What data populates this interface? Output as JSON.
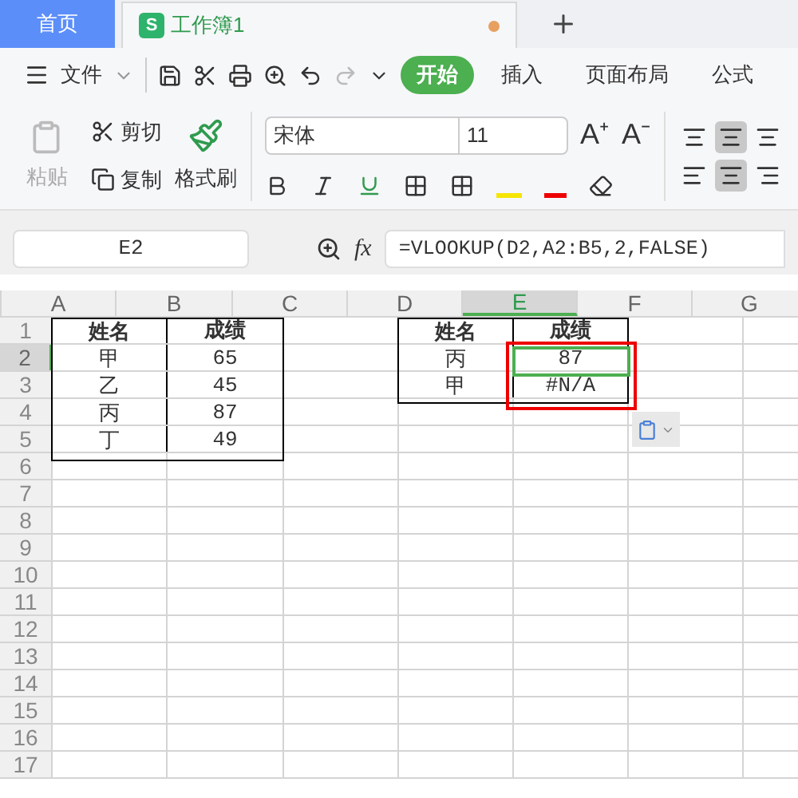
{
  "doc_tabs": [
    {
      "kind": "home",
      "label": "首页",
      "selected": false
    },
    {
      "kind": "doc",
      "badge": "S",
      "label": "工作簿1",
      "selected": true,
      "unsaved": true
    }
  ],
  "menu": {
    "file": "文件",
    "ribbon_tabs": [
      {
        "label": "开始",
        "selected": true
      },
      {
        "label": "插入",
        "selected": false
      },
      {
        "label": "页面布局",
        "selected": false
      },
      {
        "label": "公式",
        "selected": false
      }
    ]
  },
  "clipboard": {
    "paste": {
      "label": "粘贴",
      "disabled": true
    },
    "cut": "剪切",
    "copy": "复制",
    "format_painter": "格式刷"
  },
  "font": {
    "name": "宋体",
    "size": "11",
    "grow": "A⁺",
    "shrink": "A⁻"
  },
  "formula_bar": {
    "name_box": "E2",
    "fx": "fx",
    "formula": "=VLOOKUP(D2,A2:B5,2,FALSE)"
  },
  "columns": [
    {
      "label": "A",
      "selected": false
    },
    {
      "label": "B",
      "selected": false
    },
    {
      "label": "C",
      "selected": false
    },
    {
      "label": "D",
      "selected": false
    },
    {
      "label": "E",
      "selected": true
    },
    {
      "label": "F",
      "selected": false
    },
    {
      "label": "G",
      "selected": false
    }
  ],
  "rows": [
    {
      "label": "1",
      "selected": false
    },
    {
      "label": "2",
      "selected": true
    },
    {
      "label": "3",
      "selected": false
    },
    {
      "label": "4",
      "selected": false
    },
    {
      "label": "5",
      "selected": false
    },
    {
      "label": "6",
      "selected": false
    },
    {
      "label": "7",
      "selected": false
    },
    {
      "label": "8",
      "selected": false
    },
    {
      "label": "9",
      "selected": false
    },
    {
      "label": "10",
      "selected": false
    },
    {
      "label": "11",
      "selected": false
    },
    {
      "label": "12",
      "selected": false
    },
    {
      "label": "13",
      "selected": false
    },
    {
      "label": "14",
      "selected": false
    },
    {
      "label": "15",
      "selected": false
    },
    {
      "label": "16",
      "selected": false
    },
    {
      "label": "17",
      "selected": false
    }
  ],
  "table_1": [
    [
      "姓名",
      "成绩"
    ],
    [
      "甲",
      "65"
    ],
    [
      "乙",
      "45"
    ],
    [
      "丙",
      "87"
    ],
    [
      "丁",
      "49"
    ]
  ],
  "table_2": [
    [
      "姓名",
      "成绩"
    ],
    [
      "丙",
      "87"
    ],
    [
      "甲",
      "#N/A"
    ]
  ]
}
